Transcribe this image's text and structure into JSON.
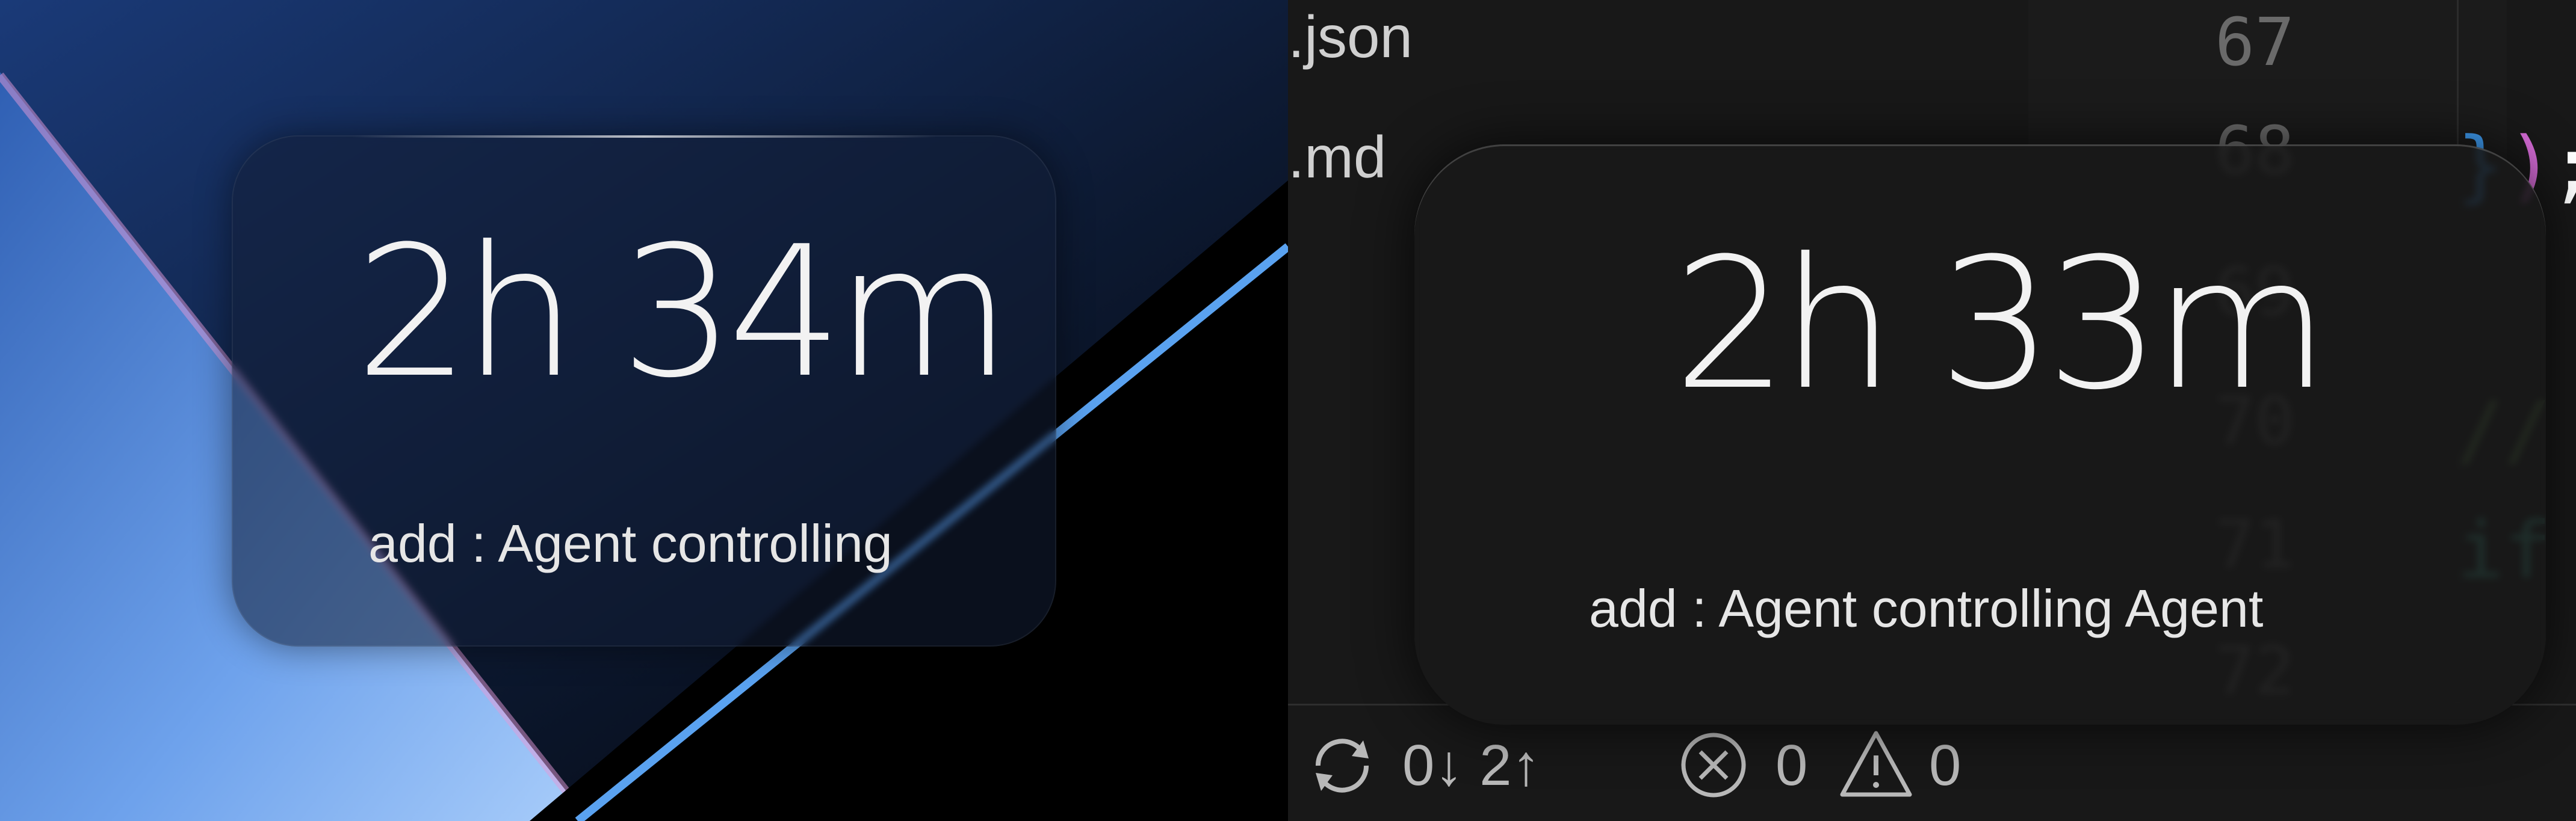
{
  "left_panel": {
    "timer": "2h 34m",
    "subtitle": "add : Agent controlling"
  },
  "right_panel": {
    "timer": "2h 33m",
    "subtitle": "add : Agent controlling Agent",
    "file_fragments": [
      ".json",
      ".md"
    ],
    "line_numbers": [
      "67",
      "68",
      "69",
      "70",
      "71",
      "72"
    ],
    "code_fragments": {
      "line68_brace": "}",
      "line68_paren": ")",
      "line68_semicolon": ";",
      "line70_comment": "//",
      "line71_keyword": "if"
    },
    "status_bar": {
      "sync_counts": "0↓ 2↑",
      "errors": "0",
      "warnings": "0"
    },
    "colors": {
      "brace": "#3f9ef5",
      "paren": "#d56bd6",
      "keyword": "#4ec9b0",
      "comment": "#6a9955"
    }
  }
}
